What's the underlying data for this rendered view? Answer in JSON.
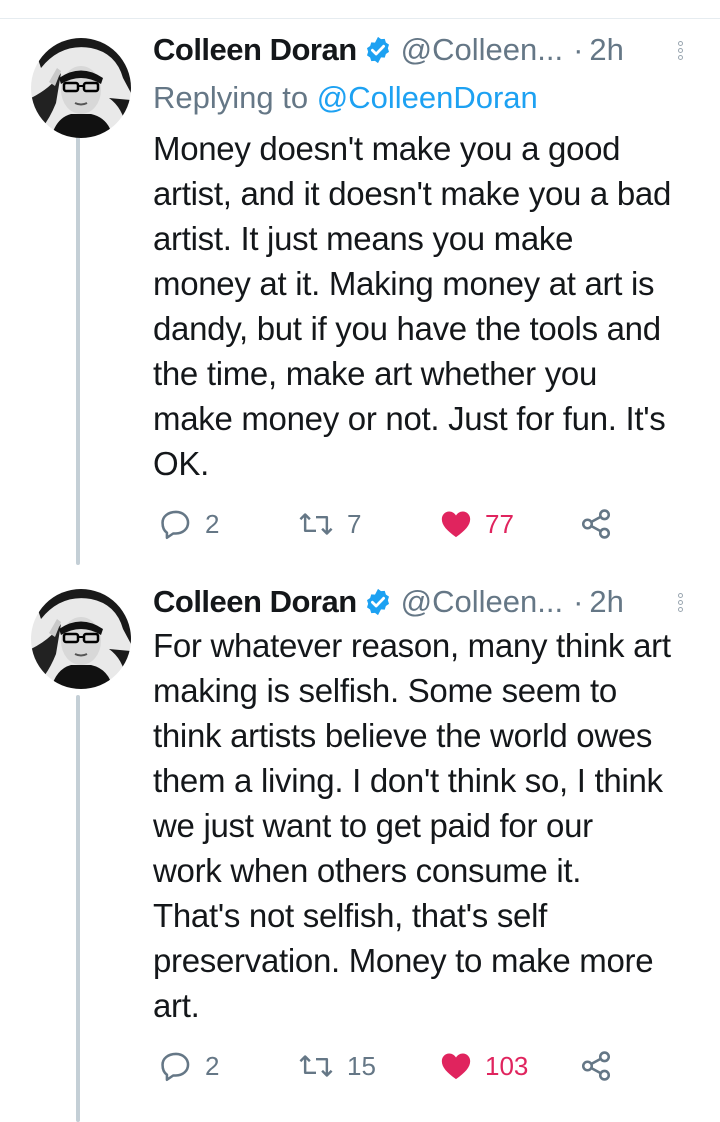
{
  "tweets": [
    {
      "author_name": "Colleen Doran",
      "handle": "@Colleen...",
      "separator": "·",
      "time": "2h",
      "replying_prefix": "Replying to ",
      "replying_to": "@ColleenDoran",
      "lines": [
        "Money doesn't make you a good",
        "artist, and it doesn't make you a bad",
        "artist. It just means you make",
        "money at it. Making money at art is",
        "dandy, but if you have the tools and",
        "the time, make art whether you",
        "make money or not. Just for fun. It's",
        "OK."
      ],
      "replies": "2",
      "retweets": "7",
      "likes": "77",
      "liked": true
    },
    {
      "author_name": "Colleen Doran",
      "handle": "@Colleen...",
      "separator": "·",
      "time": "2h",
      "lines": [
        "For whatever reason, many think art",
        "making is selfish. Some seem to",
        "think artists believe the world owes",
        "them a living. I don't think so, I think",
        "we just want to get paid for our",
        "work when others consume it.",
        "That's not selfish, that's self",
        "preservation. Money to make more",
        "art."
      ],
      "replies": "2",
      "retweets": "15",
      "likes": "103",
      "liked": true
    }
  ],
  "icons": {
    "verified": "verified-badge-icon",
    "more": "more-options-icon",
    "reply": "reply-icon",
    "retweet": "retweet-icon",
    "like": "heart-icon",
    "share": "share-icon"
  },
  "colors": {
    "brand_blue": "#1da1f2",
    "like_red": "#e0245e",
    "secondary_text": "#657786",
    "thread_line": "#c4cfd6"
  }
}
